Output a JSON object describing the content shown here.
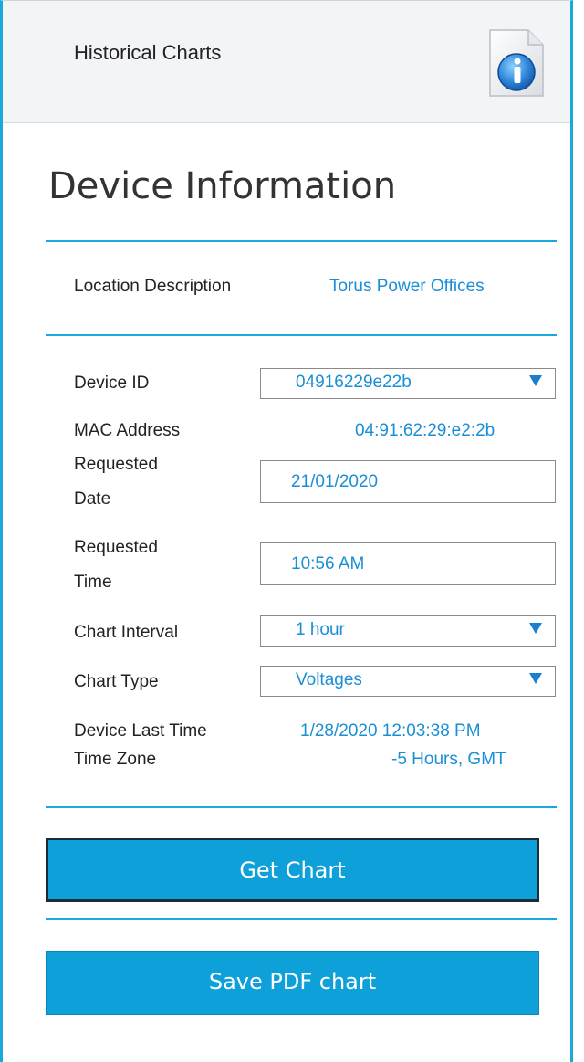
{
  "header": {
    "title": "Historical Charts"
  },
  "device_info": {
    "title": "Device Information",
    "location": {
      "label": "Location Description",
      "value": "Torus Power Offices"
    },
    "device_id": {
      "label": "Device ID",
      "selected": "04916229e22b"
    },
    "mac": {
      "label": "MAC Address",
      "value": "04:91:62:29:e2:2b"
    },
    "requested_date": {
      "label_line1": "Requested",
      "label_line2": "Date",
      "value": "21/01/2020"
    },
    "requested_time": {
      "label_line1": "Requested",
      "label_line2": "Time",
      "value": "10:56 AM"
    },
    "chart_interval": {
      "label": "Chart Interval",
      "selected": "1 hour"
    },
    "chart_type": {
      "label": "Chart Type",
      "selected": "Voltages"
    },
    "device_last_time": {
      "label": "Device Last Time",
      "value": "1/28/2020 12:03:38 PM"
    },
    "time_zone": {
      "label": "Time Zone",
      "value": "-5 Hours, GMT"
    }
  },
  "buttons": {
    "get_chart": "Get Chart",
    "save_pdf": "Save PDF chart"
  },
  "icons": {
    "info": "info-icon",
    "dropdown": "chevron-down-icon"
  },
  "colors": {
    "accent": "#1aa9dc",
    "button": "#0ea0d8",
    "value_text": "#1a8fd6"
  }
}
